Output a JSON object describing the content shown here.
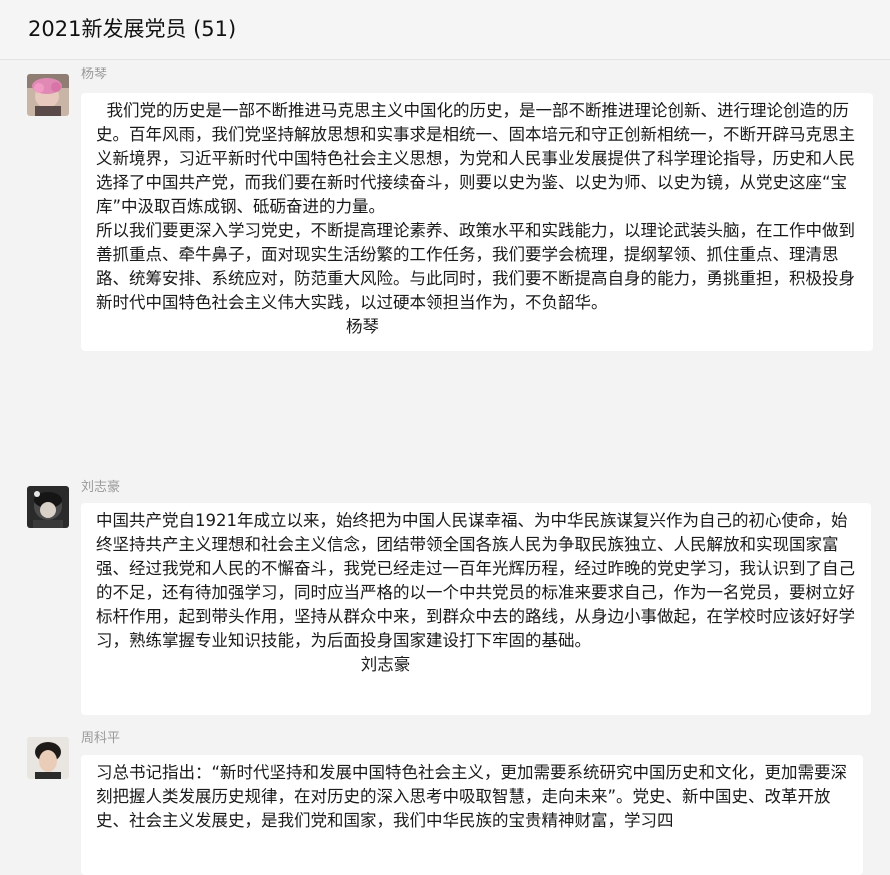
{
  "chat": {
    "title": "2021新发展党员 (51)"
  },
  "messages": [
    {
      "sender": "杨琴",
      "paragraphs": [
        "  我们党的历史是一部不断推进马克思主义中国化的历史，是一部不断推进理论创新、进行理论创造的历史。百年风雨，我们党坚持解放思想和实事求是相统一、固本培元和守正创新相统一，不断开辟马克思主义新境界，习近平新时代中国特色社会主义思想，为党和人民事业发展提供了科学理论指导，历史和人民选择了中国共产党，而我们要在新时代接续奋斗，则要以史为鉴、以史为师、以史为镜，从党史这座“宝库”中汲取百炼成钢、砥砺奋进的力量。",
        "所以我们要更深入学习党史，不断提高理论素养、政策水平和实践能力，以理论武装头脑，在工作中做到善抓重点、牵牛鼻子，面对现实生活纷繁的工作任务，我们要学会梳理，提纲挈领、抓住重点、理清思路、统筹安排、系统应对，防范重大风险。与此同时，我们要不断提高自身的能力，勇挑重担，积极投身新时代中国特色社会主义伟大实践，以过硬本领担当作为，不负韶华。"
      ],
      "signature": "杨琴"
    },
    {
      "sender": "刘志豪",
      "paragraphs": [
        "中国共产党自1921年成立以来，始终把为中国人民谋幸福、为中华民族谋复兴作为自己的初心使命，始终坚持共产主义理想和社会主义信念，团结带领全国各族人民为争取民族独立、人民解放和实现国家富强、经过我党和人民的不懈奋斗，我党已经走过一百年光辉历程，经过昨晚的党史学习，我认识到了自己的不足，还有待加强学习，同时应当严格的以一个中共党员的标准来要求自己，作为一名党员，要树立好标杆作用，起到带头作用，坚持从群众中来，到群众中去的路线，从身边小事做起，在学校时应该好好学习，熟练掌握专业知识技能，为后面投身国家建设打下牢固的基础。"
      ],
      "signature": "刘志豪"
    },
    {
      "sender": "周科平",
      "paragraphs": [
        "习总书记指出：“新时代坚持和发展中国特色社会主义，更加需要系统研究中国历史和文化，更加需要深刻把握人类发展历史规律，在对历史的深入思考中吸取智慧，走向未来”。党史、新中国史、改革开放史、社会主义发展史，是我们党和国家，我们中华民族的宝贵精神财富，学习四"
      ],
      "signature": ""
    }
  ]
}
